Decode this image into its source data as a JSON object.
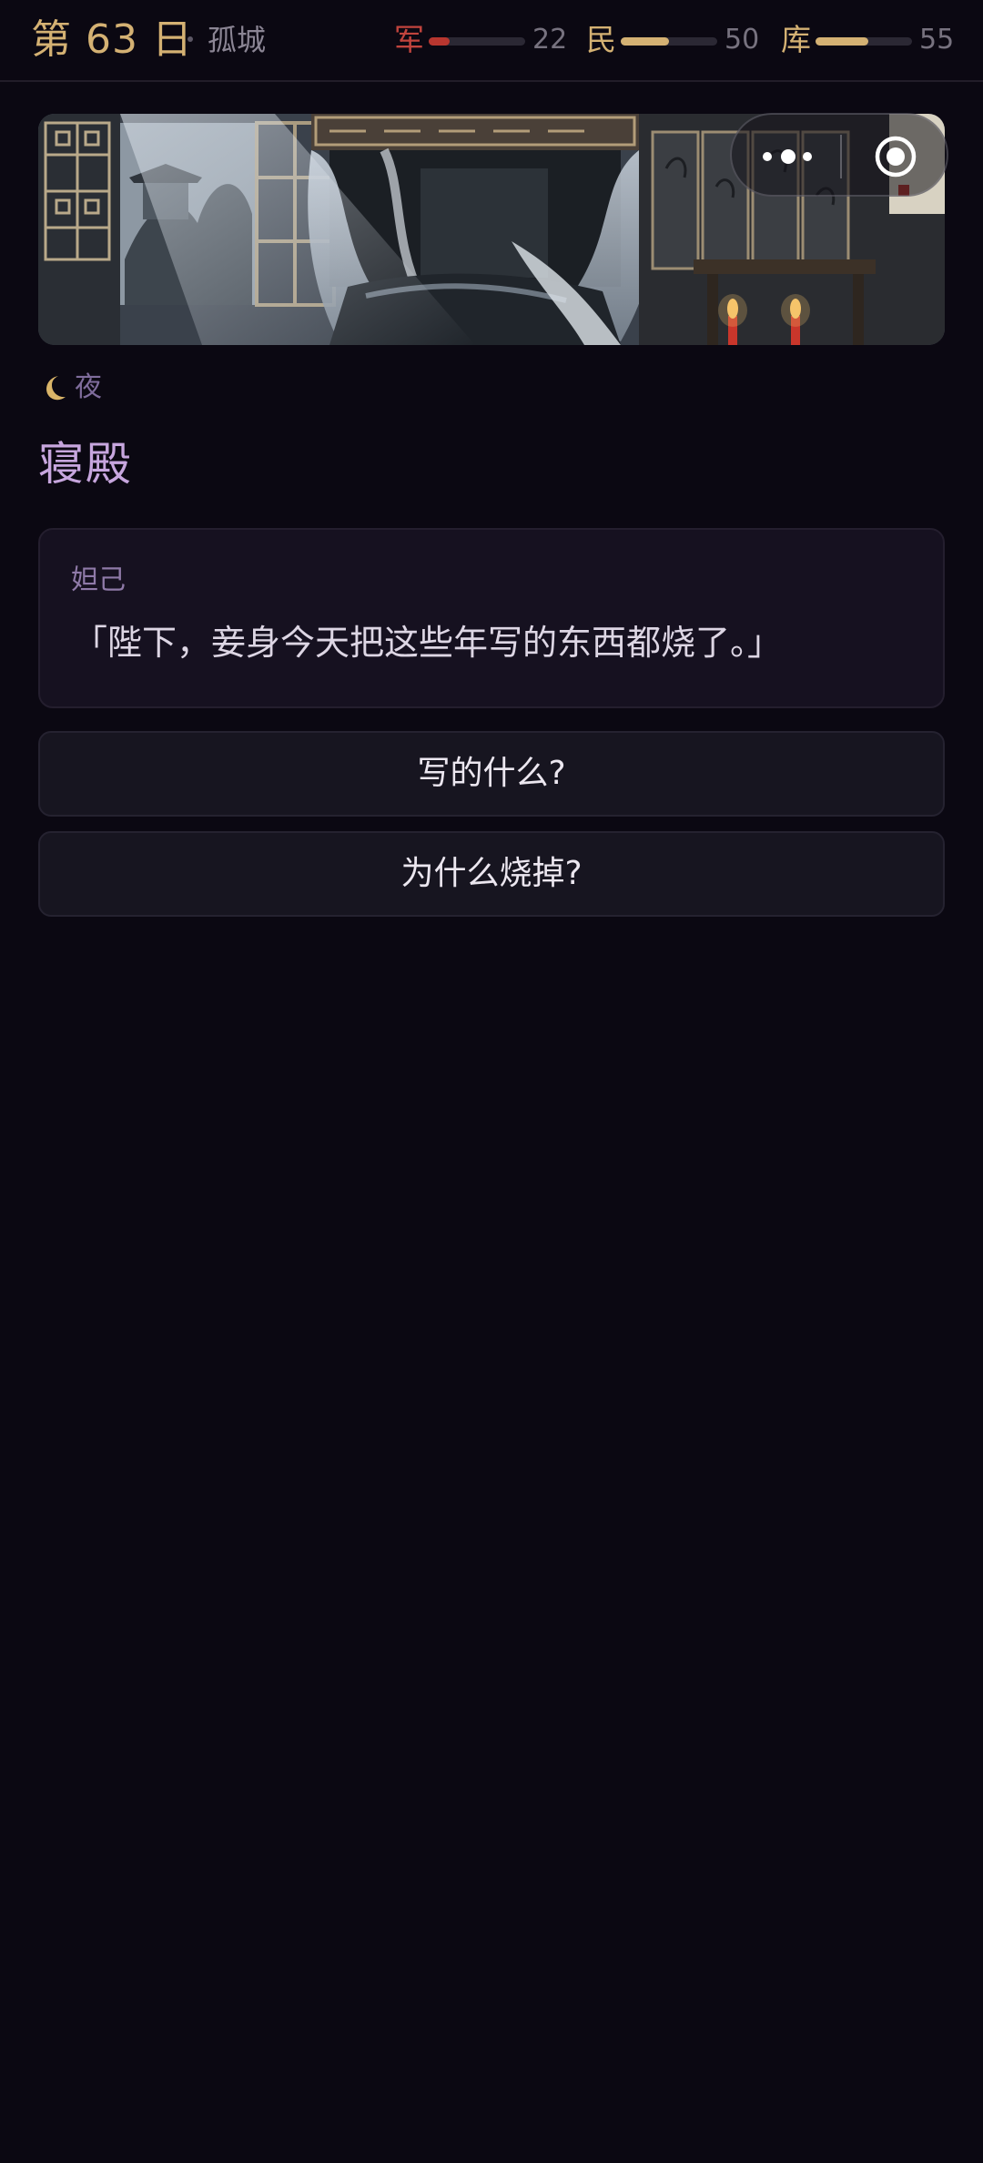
{
  "header": {
    "day_label": "第 63 日",
    "location": "孤城",
    "stats": {
      "army": {
        "label": "军",
        "value": "22",
        "level": 0.22,
        "color": "#b8362f"
      },
      "people": {
        "label": "民",
        "value": "50",
        "level": 0.5,
        "color": "#d4b173"
      },
      "treasury": {
        "label": "库",
        "value": "55",
        "level": 0.55,
        "color": "#d4b173"
      }
    }
  },
  "capsule": {
    "more_icon": "more-dots-icon",
    "close_icon": "target-close-icon"
  },
  "scene": {
    "image_icon": "bedchamber-illustration",
    "time_icon": "crescent-moon-icon",
    "time_label": "夜",
    "title": "寝殿"
  },
  "dialogue": {
    "speaker": "妲己",
    "line": "「陛下，妾身今天把这些年写的东西都烧了。」"
  },
  "choices": [
    {
      "label": "写的什么?"
    },
    {
      "label": "为什么烧掉?"
    }
  ],
  "colors": {
    "background": "#0b0812",
    "accent_gold": "#d4b173",
    "accent_purple": "#c7a6de",
    "army_red": "#c1443d"
  }
}
